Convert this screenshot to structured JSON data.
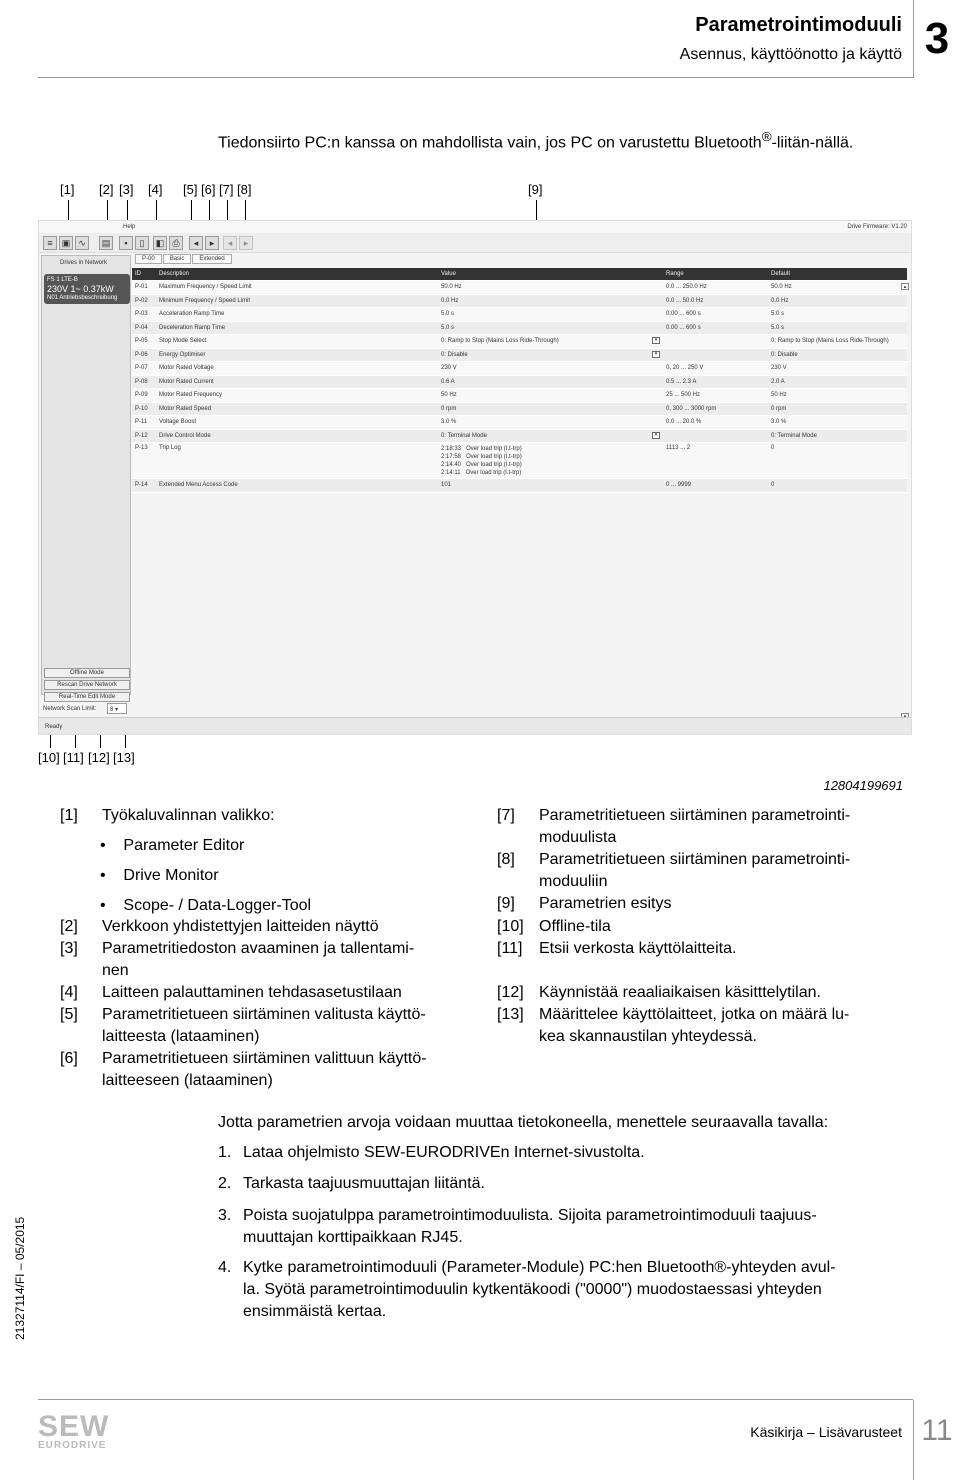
{
  "header": {
    "title": "Parametrointimoduuli",
    "subtitle": "Asennus, käyttöönotto ja käyttö",
    "chapter": "3"
  },
  "note": {
    "text": "Tiedonsiirto PC:n kanssa on mahdollista vain, jos PC on varustettu Bluetooth",
    "reg": "®",
    "text2": "-liitän-nällä."
  },
  "callouts_top": [
    "[1]",
    "[2]",
    "[3]",
    "[4]",
    "[5]",
    "[6]",
    "[7]",
    "[8]",
    "[9]"
  ],
  "callouts_bottom": [
    "[10]",
    "[11]",
    "[12]",
    "[13]"
  ],
  "app": {
    "menu": "Help",
    "firmware": "Drive Firmware: V1.20",
    "drives_label": "Drives in Network",
    "drive": {
      "line1": "FS 1  LTE-B",
      "line2": "230V 1~  0.37kW",
      "line3": "N01  Antriebsbeschreibung"
    },
    "tabs": [
      "P-00",
      "Basic",
      "Extended"
    ],
    "columns": [
      "ID",
      "Description",
      "Value",
      "Range",
      "Default"
    ],
    "rows": [
      {
        "id": "P-01",
        "desc": "Maximum Frequency / Speed Limit",
        "value": "50.0 Hz",
        "range": "0.0 ... 250.0 Hz",
        "def": "50.0 Hz"
      },
      {
        "id": "P-02",
        "desc": "Minimum Frequency / Speed Limit",
        "value": "0.0 Hz",
        "range": "0.0 ... 50.0 Hz",
        "def": "0.0 Hz"
      },
      {
        "id": "P-03",
        "desc": "Acceleration Ramp Time",
        "value": "5.0 s",
        "range": "0.00 ... 600 s",
        "def": "5.0 s"
      },
      {
        "id": "P-04",
        "desc": "Deceleration Ramp Time",
        "value": "5.0 s",
        "range": "0.00 ... 600 s",
        "def": "5.0 s"
      },
      {
        "id": "P-05",
        "desc": "Stop Mode Select",
        "value": "0: Ramp to Stop (Mains Loss Ride-Through)",
        "range": "",
        "def": "0: Ramp to Stop (Mains Loss Ride-Through)",
        "dropdown": true
      },
      {
        "id": "P-06",
        "desc": "Energy Optimiser",
        "value": "0: Disable",
        "range": "",
        "def": "0: Disable",
        "dropdown": true
      },
      {
        "id": "P-07",
        "desc": "Motor Rated Voltage",
        "value": "230 V",
        "range": "0, 20 ... 250 V",
        "def": "230 V"
      },
      {
        "id": "P-08",
        "desc": "Motor Rated Current",
        "value": "0.6 A",
        "range": "0.5 ... 2.3 A",
        "def": "2.0 A"
      },
      {
        "id": "P-09",
        "desc": "Motor Rated Frequency",
        "value": "50 Hz",
        "range": "25 ... 500 Hz",
        "def": "50 Hz"
      },
      {
        "id": "P-10",
        "desc": "Motor Rated Speed",
        "value": "0 rpm",
        "range": "0, 300 ... 3000 rpm",
        "def": "0 rpm"
      },
      {
        "id": "P-11",
        "desc": "Voltage Boost",
        "value": "3.0 %",
        "range": "0.0 ... 20.0 %",
        "def": "3.0 %"
      },
      {
        "id": "P-12",
        "desc": "Drive Control Mode",
        "value": "0: Terminal Mode",
        "range": "",
        "def": "0: Terminal Mode",
        "dropdown": true
      },
      {
        "id": "P-13",
        "desc": "Trip Log",
        "value": "2:18:33   Over load trip (I.t-trp)\n2:17:58   Over load trip (I.t-trp)\n2:14:40   Over load trip (I.t-trp)\n2:14:11   Over load trip (I.t-trp)",
        "range": "1113 ... 2",
        "def": "0",
        "multi": true
      },
      {
        "id": "P-14",
        "desc": "Extended Menu Access Code",
        "value": "101",
        "range": "0 ... 9999",
        "def": "0"
      }
    ],
    "buttons": {
      "offline": "Offline Mode",
      "rescan": "Rescan Drive Network",
      "realtime": "Real-Time Edit Mode"
    },
    "scan_label": "Network Scan Limit:",
    "scan_value": "8",
    "status": "Ready"
  },
  "image_number": "12804199691",
  "legend_left": [
    {
      "n": "[1]",
      "t": "Työkaluvalinnan valikko:"
    },
    {
      "n": "[2]",
      "t": "Verkkoon yhdistettyjen laitteiden näyttö"
    },
    {
      "n": "[3]",
      "t": "Parametritiedoston avaaminen ja tallentami-\nnen"
    },
    {
      "n": "[4]",
      "t": "Laitteen palauttaminen tehdasasetustilaan"
    },
    {
      "n": "[5]",
      "t": "Parametritietueen siirtäminen valitusta käyttö-\nlaitteesta (lataaminen)"
    },
    {
      "n": "[6]",
      "t": "Parametritietueen siirtäminen valittuun käyttö-\nlaitteeseen (lataaminen)"
    }
  ],
  "bullets": [
    "Parameter Editor",
    "Drive Monitor",
    "Scope- / Data-Logger-Tool"
  ],
  "legend_right": [
    {
      "n": "[7]",
      "t": "Parametritietueen siirtäminen parametrointi-\nmoduulista"
    },
    {
      "n": "[8]",
      "t": "Parametritietueen siirtäminen parametrointi-\nmoduuliin"
    },
    {
      "n": "[9]",
      "t": "Parametrien esitys"
    },
    {
      "n": "[10]",
      "t": "Offline-tila"
    },
    {
      "n": "[11]",
      "t": "Etsii verkosta käyttölaitteita."
    },
    {
      "n": "[12]",
      "t": "Käynnistää reaaliaikaisen käsitttelytilan."
    },
    {
      "n": "[13]",
      "t": "Määrittelee käyttölaitteet, jotka on määrä lu-\nkea skannaustilan yhteydessä."
    }
  ],
  "intro": "Jotta parametrien arvoja voidaan muuttaa tietokoneella, menettele seuraavalla tavalla:",
  "steps": [
    {
      "n": "1.",
      "t": "Lataa ohjelmisto SEW-EURODRIVEn Internet-sivustolta."
    },
    {
      "n": "2.",
      "t": "Tarkasta taajuusmuuttajan liitäntä."
    },
    {
      "n": "3.",
      "t": "Poista suojatulppa parametrointimoduulista. Sijoita parametrointimoduuli taajuus-\nmuuttajan korttipaikkaan RJ45."
    },
    {
      "n": "4.",
      "t": "Kytke parametrointimoduuli (Parameter-Module) PC:hen Bluetooth®-yhteyden avul-\nla. Syötä parametrointimoduulin kytkentäkoodi (\"0000\") muodostaessasi yhteyden\nensimmäistä kertaa."
    }
  ],
  "side_code": "21327114/FI – 05/2015",
  "footer": {
    "logo": "SEW EURODRIVE",
    "book": "Käsikirja – Lisävarusteet",
    "page": "11"
  }
}
